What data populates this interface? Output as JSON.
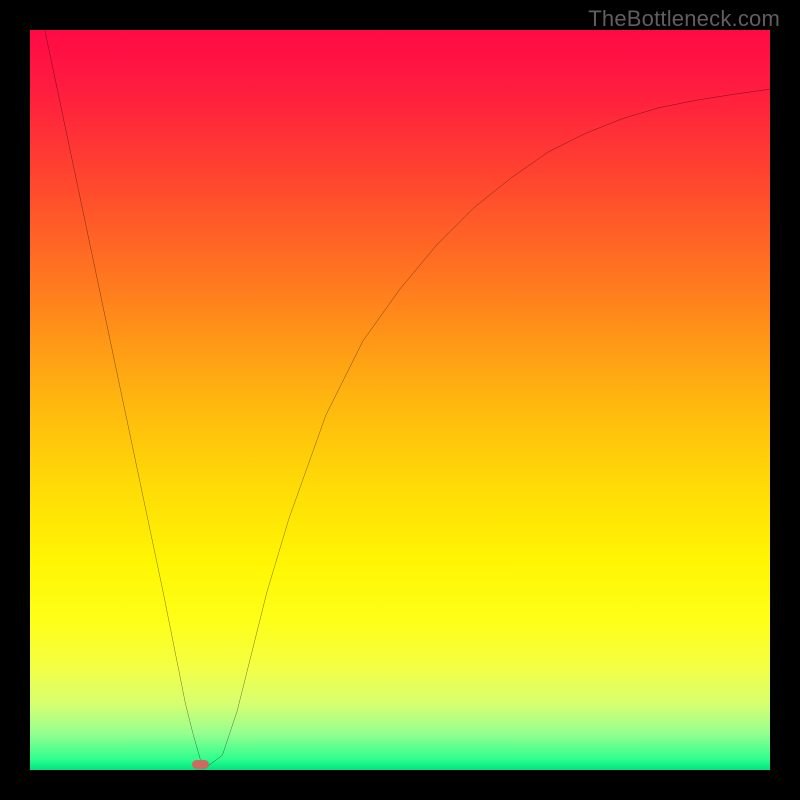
{
  "watermark": "TheBottleneck.com",
  "chart_data": {
    "type": "line",
    "title": "",
    "xlabel": "",
    "ylabel": "",
    "xlim": [
      0,
      100
    ],
    "ylim": [
      0,
      100
    ],
    "grid": false,
    "legend": false,
    "background_gradient_stops": [
      {
        "offset": 0.0,
        "color": "#ff0a46"
      },
      {
        "offset": 0.08,
        "color": "#ff1c3f"
      },
      {
        "offset": 0.2,
        "color": "#ff452f"
      },
      {
        "offset": 0.35,
        "color": "#ff7c1e"
      },
      {
        "offset": 0.5,
        "color": "#ffb60f"
      },
      {
        "offset": 0.62,
        "color": "#ffdc06"
      },
      {
        "offset": 0.72,
        "color": "#fff603"
      },
      {
        "offset": 0.8,
        "color": "#feff18"
      },
      {
        "offset": 0.86,
        "color": "#f4ff43"
      },
      {
        "offset": 0.91,
        "color": "#d7ff70"
      },
      {
        "offset": 0.95,
        "color": "#97ff8f"
      },
      {
        "offset": 0.985,
        "color": "#30ff8e"
      },
      {
        "offset": 1.0,
        "color": "#00e380"
      }
    ],
    "series": [
      {
        "name": "curve",
        "color": "#000000",
        "width": 2,
        "x": [
          2,
          4,
          6,
          8,
          10,
          12,
          14,
          16,
          18,
          20,
          21,
          22,
          23,
          24,
          26,
          28,
          30,
          32,
          35,
          40,
          45,
          50,
          55,
          60,
          65,
          70,
          75,
          80,
          85,
          90,
          95,
          100
        ],
        "y": [
          100,
          90.5,
          81,
          71.5,
          62,
          52.5,
          43,
          33.5,
          24,
          14,
          9,
          5,
          1.5,
          0.5,
          2,
          8,
          16,
          24,
          34,
          48,
          58,
          65,
          71,
          76,
          80,
          83.5,
          86,
          88,
          89.5,
          90.5,
          91.3,
          92
        ]
      }
    ],
    "marker": {
      "name": "optimal-point",
      "color": "#cd6b60",
      "x": 23,
      "y": 0.8,
      "w_pct": 2.3,
      "h_pct": 1.2,
      "rx": 6
    }
  }
}
